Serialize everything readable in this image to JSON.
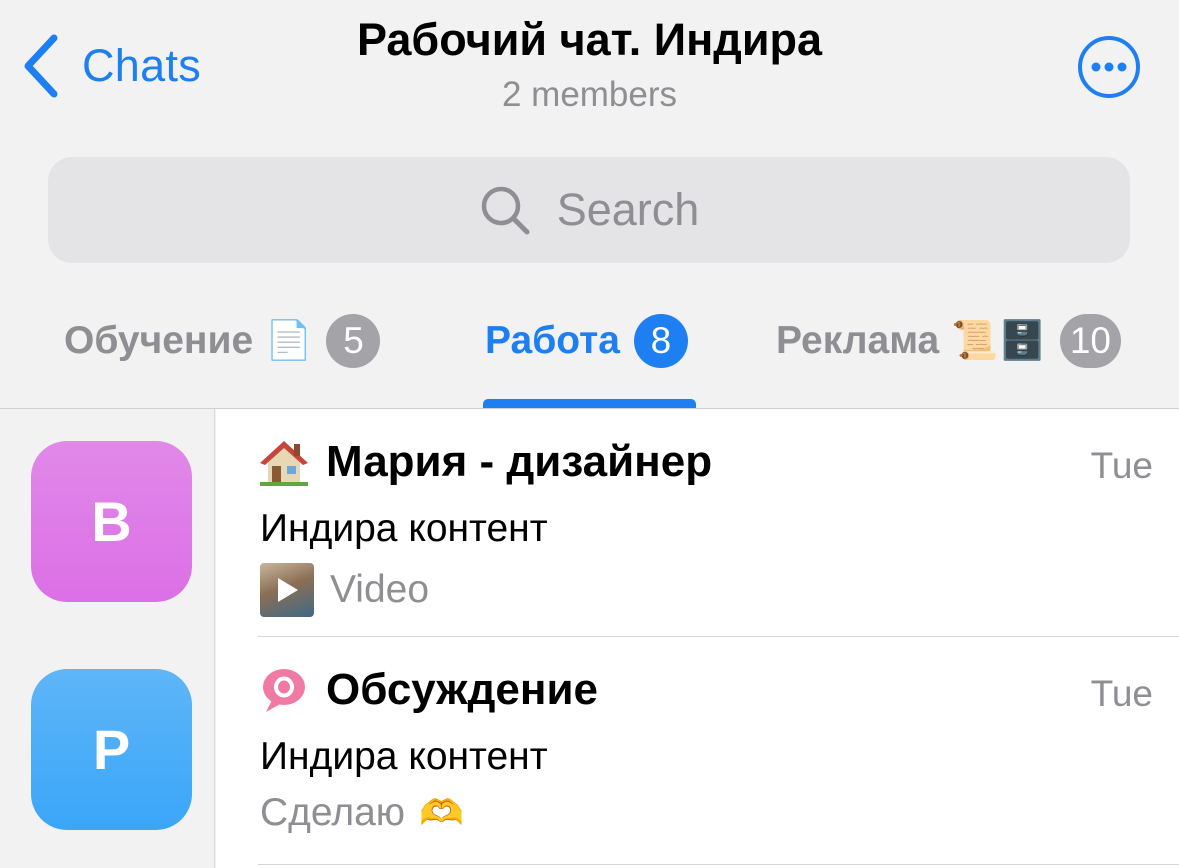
{
  "header": {
    "back_label": "Chats",
    "title": "Рабочий чат. Индира",
    "subtitle": "2 members"
  },
  "search": {
    "placeholder": "Search"
  },
  "tabs": [
    {
      "label": "Обучение",
      "emoji": "📄",
      "badge": "5",
      "active": false
    },
    {
      "label": "Работа",
      "emoji": "",
      "badge": "8",
      "active": true
    },
    {
      "label": "Реклама",
      "emoji": "📜🗄️",
      "badge": "10",
      "active": false
    }
  ],
  "chats": [
    {
      "avatar_letter": "B",
      "avatar_color": "#dc6fe6",
      "icon": "house-icon",
      "name": "Мария - дизайнер",
      "time": "Tue",
      "sender": "Индира контент",
      "message": "Video"
    },
    {
      "avatar_letter": "P",
      "avatar_color": "#3aa6f8",
      "icon": "speech-bubble-icon",
      "name": "Обсуждение",
      "time": "Tue",
      "sender": "Индира контент",
      "message": "Сделаю",
      "message_emoji": "🫶"
    }
  ],
  "colors": {
    "accent": "#1d7ff2",
    "badge_inactive": "#a3a3a8"
  }
}
